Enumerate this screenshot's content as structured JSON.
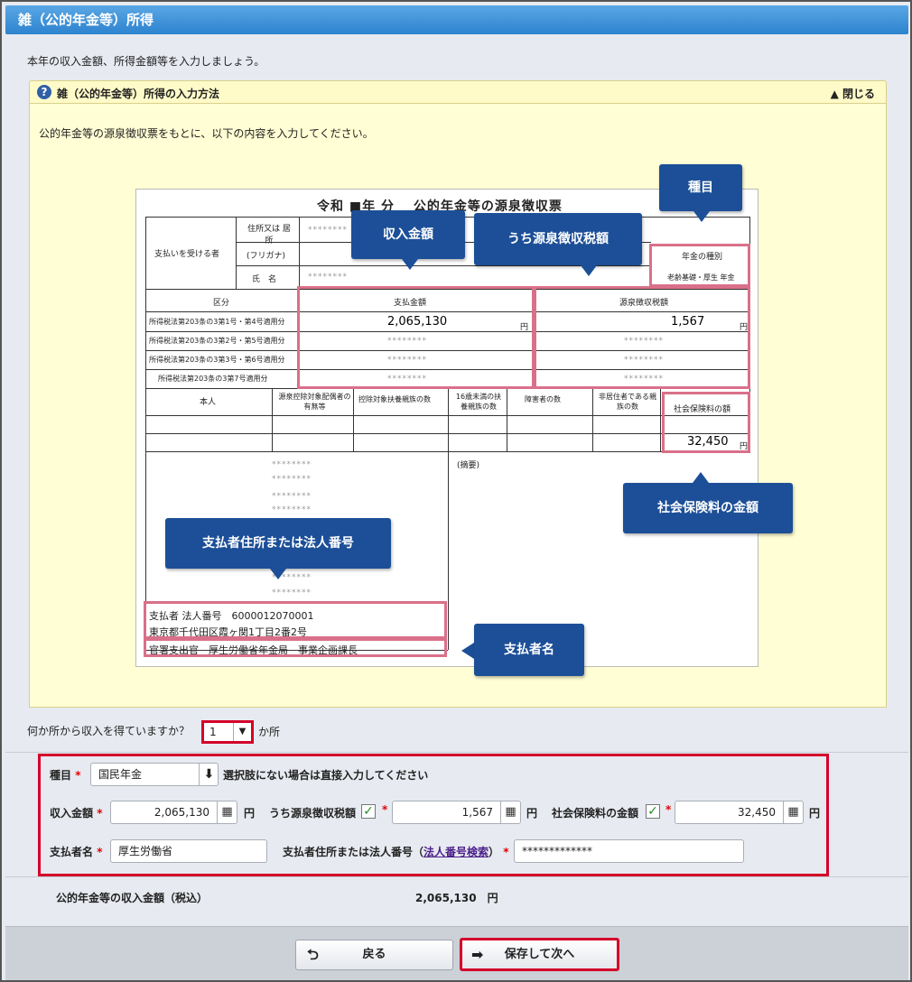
{
  "title": "雑（公的年金等）所得",
  "intro": "本年の収入金額、所得金額等を入力しましょう。",
  "howto": {
    "title": "雑（公的年金等）所得の入力方法",
    "close_label": "▲ 閉じる",
    "desc": "公的年金等の源泉徴収票をもとに、以下の内容を入力してください。",
    "form": {
      "title": "令和 ■年 分　 公的年金等の源泉徴収票",
      "recipient_label": "支払いを受ける者",
      "address_label": "住所又は 居所",
      "furigana_label": "(フリガナ)",
      "name_label": "氏　名",
      "pension_type_label": "年金の種別",
      "pension_type_value": "老齢基礎・厚生 年金",
      "category_label": "区分",
      "paid_label": "支払金額",
      "withheld_label": "源泉徴収税額",
      "rows": [
        "所得税法第203条の3第1号・第4号適用分",
        "所得税法第203条の3第2号・第5号適用分",
        "所得税法第203条の3第3号・第6号適用分",
        "所得税法第203条の3第7号適用分"
      ],
      "paid_amount": "2,065,130",
      "withheld_amount": "1,567",
      "yen": "円",
      "masked": "********",
      "self_label": "本人",
      "spouse_label": "源泉控除対象配偶者の有無等",
      "dependent_label": "控除対象扶養親族の数",
      "under16_label": "16歳未満の扶養親族の数",
      "disabled_label": "障害者の数",
      "nonresident_label": "非居住者である親族の数",
      "social_label": "社会保険料の額",
      "social_amount": "32,450",
      "payer_number_line": "支払者 法人番号　6000012070001",
      "payer_address_line": "東京都千代田区霞ヶ関1丁目2番2号",
      "payer_name_line": "官署支出官　厚生労働省年金局　事業企画課長",
      "remarks_label": "(摘要)"
    },
    "callouts": {
      "type": "種目",
      "income": "収入金額",
      "withheld": "うち源泉徴収税額",
      "social": "社会保険料の金額",
      "payer_address": "支払者住所または法人番号",
      "payer_name": "支払者名"
    }
  },
  "count": {
    "question": "何か所から収入を得ていますか？",
    "value": "1",
    "suffix": "か所"
  },
  "entry": {
    "type_label": "種目",
    "type_value": "国民年金",
    "type_hint": "選択肢にない場合は直接入力してください",
    "income_label": "収入金額",
    "income_value": "2,065,130",
    "withheld_label": "うち源泉徴収税額",
    "withheld_value": "1,567",
    "social_label": "社会保険料の金額",
    "social_value": "32,450",
    "yen": "円",
    "payer_name_label": "支払者名",
    "payer_name_value": "厚生労働省",
    "payer_address_label": "支払者住所または法人番号",
    "payer_lookup_link": "法人番号検索",
    "payer_address_value": "*************"
  },
  "total": {
    "label": "公的年金等の収入金額（税込）",
    "value": "2,065,130　円"
  },
  "buttons": {
    "back": "戻る",
    "next": "保存して次へ"
  }
}
